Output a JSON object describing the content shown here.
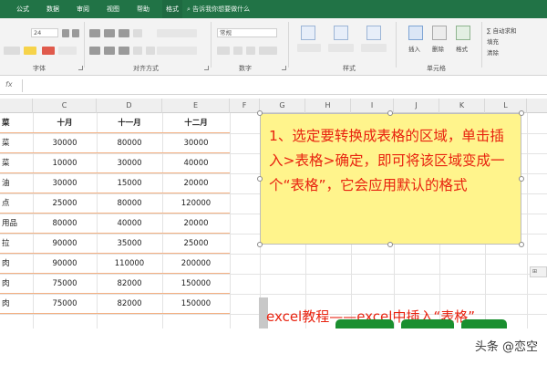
{
  "ribbon": {
    "tabs": [
      "公式",
      "数据",
      "审阅",
      "视图",
      "帮助",
      "格式"
    ],
    "search_placeholder": "告诉我你想要做什么",
    "font_size": "24",
    "font_name": "常规",
    "groups": {
      "font": "字体",
      "alignment": "对齐方式",
      "number": "数字",
      "styles": "样式",
      "cells": "单元格"
    },
    "cells": {
      "insert": "插入",
      "delete": "删除",
      "format": "格式"
    },
    "right": {
      "autosum": "∑ 自动求和",
      "fill": "填充",
      "clear": "清除"
    },
    "icons": {
      "search": "search-icon",
      "formula": "fx-icon"
    }
  },
  "formula_bar": {
    "fx": "fx"
  },
  "grid": {
    "columns": [
      "C",
      "D",
      "E",
      "F",
      "G",
      "H",
      "I",
      "J",
      "K",
      "L"
    ],
    "table": {
      "headers": [
        "十月",
        "十一月",
        "十二月"
      ],
      "row_labels": [
        "菜",
        "菜",
        "油",
        "点",
        "用品",
        "拉",
        "肉",
        "肉",
        "肉"
      ],
      "rows": [
        [
          "30000",
          "80000",
          "30000"
        ],
        [
          "10000",
          "30000",
          "40000"
        ],
        [
          "30000",
          "15000",
          "20000"
        ],
        [
          "25000",
          "80000",
          "120000"
        ],
        [
          "80000",
          "40000",
          "20000"
        ],
        [
          "90000",
          "35000",
          "25000"
        ],
        [
          "90000",
          "110000",
          "200000"
        ],
        [
          "75000",
          "82000",
          "150000"
        ],
        [
          "75000",
          "82000",
          "150000"
        ]
      ]
    }
  },
  "callout": {
    "text": "1、选定要转换成表格的区域，单击插入>表格>确定，即可将该区域变成一个“表格”，它会应用默认的格式"
  },
  "footer": {
    "title": "excel教程——excel中插入“表格”"
  },
  "watermark": "头条 @恋空",
  "colors": {
    "ribbon": "#217346",
    "callout_bg": "#fff48c",
    "callout_text": "#e8220f",
    "table_rule": "#f4b183"
  }
}
